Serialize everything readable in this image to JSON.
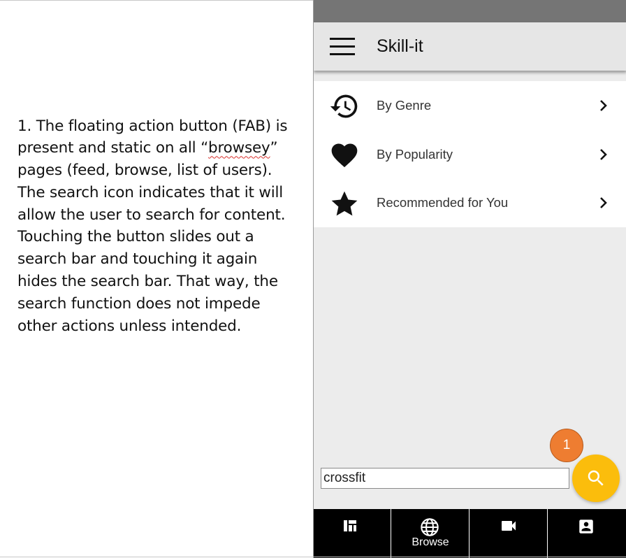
{
  "annotation": {
    "text_before": "1. The floating action button (FAB) is present and static on all “",
    "squiggle_word": "browsey",
    "text_after": "” pages (feed, browse, list of users). The search icon indicates that it will allow the user to search for content. Touching the button slides out a search bar and touching it again hides the search bar. That way, the search function does not impede other actions unless intended."
  },
  "app": {
    "title": "Skill-it",
    "menu_icon": "hamburger-menu-icon"
  },
  "menu": {
    "items": [
      {
        "label": "By Genre",
        "icon": "history-icon"
      },
      {
        "label": "By Popularity",
        "icon": "heart-icon"
      },
      {
        "label": "Recommended for You",
        "icon": "star-icon"
      }
    ]
  },
  "search": {
    "value": "crossfit",
    "fab_icon": "search-icon"
  },
  "callout": {
    "number": "1"
  },
  "bottom_nav": {
    "items": [
      {
        "icon": "dashboard-icon",
        "label": ""
      },
      {
        "icon": "globe-icon",
        "label": "Browse"
      },
      {
        "icon": "video-camera-icon",
        "label": ""
      },
      {
        "icon": "account-box-icon",
        "label": ""
      }
    ]
  },
  "colors": {
    "status_bar": "#757575",
    "app_bar": "#e6e6e6",
    "fab": "#fbbd0c",
    "callout": "#ee7d31",
    "bottom_nav": "#000000",
    "squiggle": "#d9302c"
  }
}
